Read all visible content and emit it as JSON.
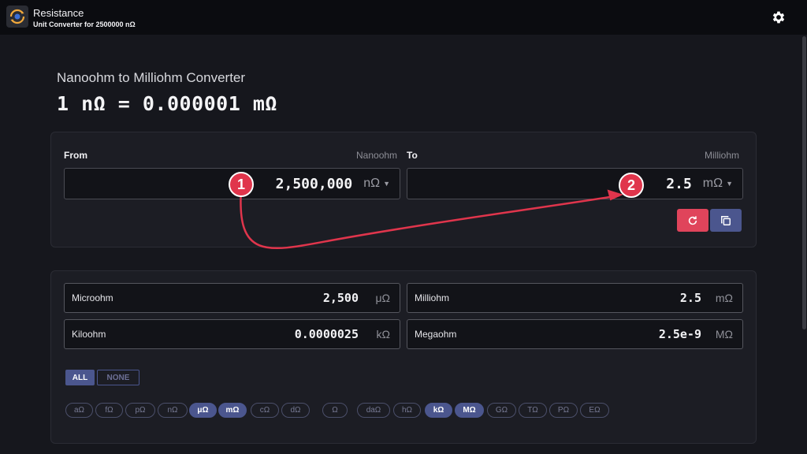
{
  "app": {
    "title": "Resistance",
    "subtitle": "Unit Converter for 2500000 nΩ",
    "logo_icon": "conversion-icon",
    "settings_icon": "gear-icon"
  },
  "heading": "Nanoohm to Milliohm Converter",
  "formula": "1 nΩ = 0.000001 mΩ",
  "converter": {
    "from_label": "From",
    "from_unit_name": "Nanoohm",
    "from_value": "2,500,000",
    "from_symbol": "nΩ",
    "to_label": "To",
    "to_unit_name": "Milliohm",
    "to_value": "2.5",
    "to_symbol": "mΩ",
    "reset_icon": "reset-icon",
    "copy_icon": "copy-icon"
  },
  "results": [
    {
      "name": "Microohm",
      "value": "2,500",
      "symbol": "μΩ"
    },
    {
      "name": "Milliohm",
      "value": "2.5",
      "symbol": "mΩ"
    },
    {
      "name": "Kiloohm",
      "value": "0.0000025",
      "symbol": "kΩ"
    },
    {
      "name": "Megaohm",
      "value": "2.5e-9",
      "symbol": "MΩ"
    }
  ],
  "filters": {
    "all_label": "ALL",
    "none_label": "NONE",
    "units": [
      {
        "symbol": "aΩ",
        "on": false
      },
      {
        "symbol": "fΩ",
        "on": false
      },
      {
        "symbol": "pΩ",
        "on": false
      },
      {
        "symbol": "nΩ",
        "on": false
      },
      {
        "symbol": "μΩ",
        "on": true
      },
      {
        "symbol": "mΩ",
        "on": true
      },
      {
        "symbol": "cΩ",
        "on": false
      },
      {
        "symbol": "dΩ",
        "on": false
      },
      {
        "symbol": "Ω",
        "on": false
      },
      {
        "symbol": "daΩ",
        "on": false
      },
      {
        "symbol": "hΩ",
        "on": false
      },
      {
        "symbol": "kΩ",
        "on": true
      },
      {
        "symbol": "MΩ",
        "on": true
      },
      {
        "symbol": "GΩ",
        "on": false
      },
      {
        "symbol": "TΩ",
        "on": false
      },
      {
        "symbol": "PΩ",
        "on": false
      },
      {
        "symbol": "EΩ",
        "on": false
      }
    ]
  },
  "annotations": {
    "marker_1": "1",
    "marker_2": "2",
    "marker_color": "#e0354c"
  },
  "colors": {
    "accent": "#4b568e",
    "reset": "#e0445b",
    "background": "#16171d"
  }
}
